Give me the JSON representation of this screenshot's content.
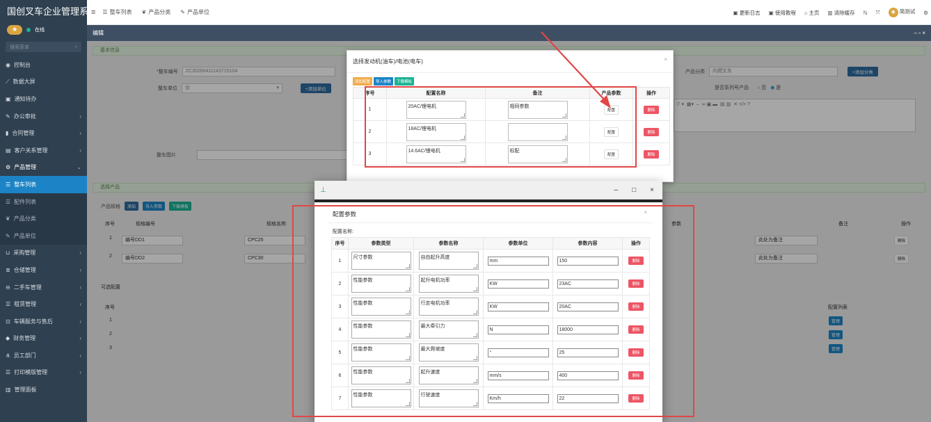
{
  "app": {
    "brand": "国创叉车企业管理系",
    "user_status": "在线",
    "search_placeholder": "搜索菜单"
  },
  "sidebar": {
    "items": [
      {
        "label": "控制台",
        "icon": "dashboard-icon"
      },
      {
        "label": "数据大屏",
        "icon": "chart-icon"
      },
      {
        "label": "通知待办",
        "icon": "calendar-icon"
      },
      {
        "label": "办公审批",
        "icon": "wrench-icon"
      },
      {
        "label": "合同管理",
        "icon": "book-icon"
      },
      {
        "label": "客户关系管理",
        "icon": "id-card-icon"
      },
      {
        "label": "产品管理",
        "icon": "cog-icon"
      },
      {
        "label": "整车列表",
        "icon": "list-icon"
      },
      {
        "label": "配件列表",
        "icon": "list-icon"
      },
      {
        "label": "产品分类",
        "icon": "leaf-icon"
      },
      {
        "label": "产品单位",
        "icon": "wrench-icon"
      },
      {
        "label": "采购管理",
        "icon": "cart-icon"
      },
      {
        "label": "仓储管理",
        "icon": "database-icon"
      },
      {
        "label": "二手车管理",
        "icon": "car-icon"
      },
      {
        "label": "租赁管理",
        "icon": "list-icon"
      },
      {
        "label": "车辆服务与售后",
        "icon": "truck-icon"
      },
      {
        "label": "财务管理",
        "icon": "diamond-icon"
      },
      {
        "label": "员工部门",
        "icon": "sitemap-icon"
      },
      {
        "label": "打印模版管理",
        "icon": "list-icon"
      },
      {
        "label": "管理面板",
        "icon": "bar-chart-icon"
      }
    ]
  },
  "tabs": [
    {
      "label": "整车列表"
    },
    {
      "label": "产品分类"
    },
    {
      "label": "产品单位"
    }
  ],
  "top_right": [
    "更新日志",
    "使用教程",
    "主页",
    "清除缓存",
    "简测试"
  ],
  "edit_bar": {
    "title": "编辑",
    "controls": "– ▫ ×"
  },
  "form": {
    "section_basic": "基本信息",
    "vehicle_no_label": "*整车编号",
    "vehicle_no_value": "ZC20260411143715104",
    "unit_label": "整车单位",
    "unit_value": "台",
    "add_unit": "+添加单位",
    "category_label": "产品分类",
    "category_value": "内燃叉车",
    "add_category": "+添加分类",
    "series_label": "是否系列号产品",
    "series_no": "否",
    "series_yes": "是",
    "image_label": "整车图片",
    "section_product": "选择产品",
    "spec_label": "产品规格",
    "add_btn": "添加",
    "import_btn": "导入参数",
    "download_btn": "下载模板",
    "bg_table_headers": [
      "序号",
      "规格编号",
      "规格名称",
      "参数",
      "备注",
      "操作"
    ],
    "bg_rows": [
      {
        "no": "1",
        "code": "编号DD1",
        "name": "CPC25",
        "note": "此处为备注",
        "op": "删除"
      },
      {
        "no": "2",
        "code": "编号DD2",
        "name": "CPC30",
        "note": "此处为备注",
        "op": "删除"
      }
    ],
    "optional_label": "可选配置",
    "optional_headers": [
      "序号",
      "配置列表"
    ],
    "optional_rows": [
      {
        "no": "1",
        "op": "管理"
      },
      {
        "no": "2",
        "op": "管理"
      },
      {
        "no": "3",
        "op": "管理"
      }
    ]
  },
  "dialog1": {
    "title": "选择发动机(油车)/电池(电车)",
    "close": "×",
    "toolbar": [
      "添加配置",
      "导入参数",
      "下载模板"
    ],
    "headers": [
      "序号",
      "配置名称",
      "备注",
      "产品参数",
      "操作"
    ],
    "rows": [
      {
        "no": "1",
        "name": "20AC/锂电机",
        "note": "相同参数",
        "param_btn": "配置",
        "del_btn": "删除"
      },
      {
        "no": "2",
        "name": "18AC/锂电机",
        "note": "",
        "param_btn": "配置",
        "del_btn": "删除"
      },
      {
        "no": "3",
        "name": "14.6AC/锂电机",
        "note": "标配",
        "param_btn": "配置",
        "del_btn": "删除"
      }
    ]
  },
  "window": {
    "pin": "⊥",
    "min": "–",
    "max": "□",
    "close": "×"
  },
  "dialog2": {
    "title": "配置参数",
    "close": "×",
    "name_label": "配置名称:",
    "headers": [
      "序号",
      "参数类型",
      "参数名称",
      "参数单位",
      "参数内容",
      "操作"
    ],
    "rows": [
      {
        "no": "1",
        "type": "尺寸参数",
        "name": "自由起升高度",
        "unit": "mm",
        "value": "150",
        "del": "删除"
      },
      {
        "no": "2",
        "type": "性能参数",
        "name": "起升电机功率",
        "unit": "KW",
        "value": "23AC",
        "del": "删除"
      },
      {
        "no": "3",
        "type": "性能参数",
        "name": "行走电机功率",
        "unit": "KW",
        "value": "20AC",
        "del": "删除"
      },
      {
        "no": "4",
        "type": "性能参数",
        "name": "最大牵引力",
        "unit": "N",
        "value": "18000",
        "del": "删除"
      },
      {
        "no": "5",
        "type": "性能参数",
        "name": "最大爬坡度",
        "unit": "°",
        "value": "25",
        "del": "删除"
      },
      {
        "no": "6",
        "type": "性能参数",
        "name": "起升速度",
        "unit": "mm/s",
        "value": "400",
        "del": "删除"
      },
      {
        "no": "7",
        "type": "性能参数",
        "name": "行驶速度",
        "unit": "Km/h",
        "value": "22",
        "del": "删除"
      }
    ]
  },
  "colors": {
    "sidebar": "#2f4050",
    "active": "#1c84c6",
    "danger": "#ed5565",
    "highlight": "#e24646"
  }
}
